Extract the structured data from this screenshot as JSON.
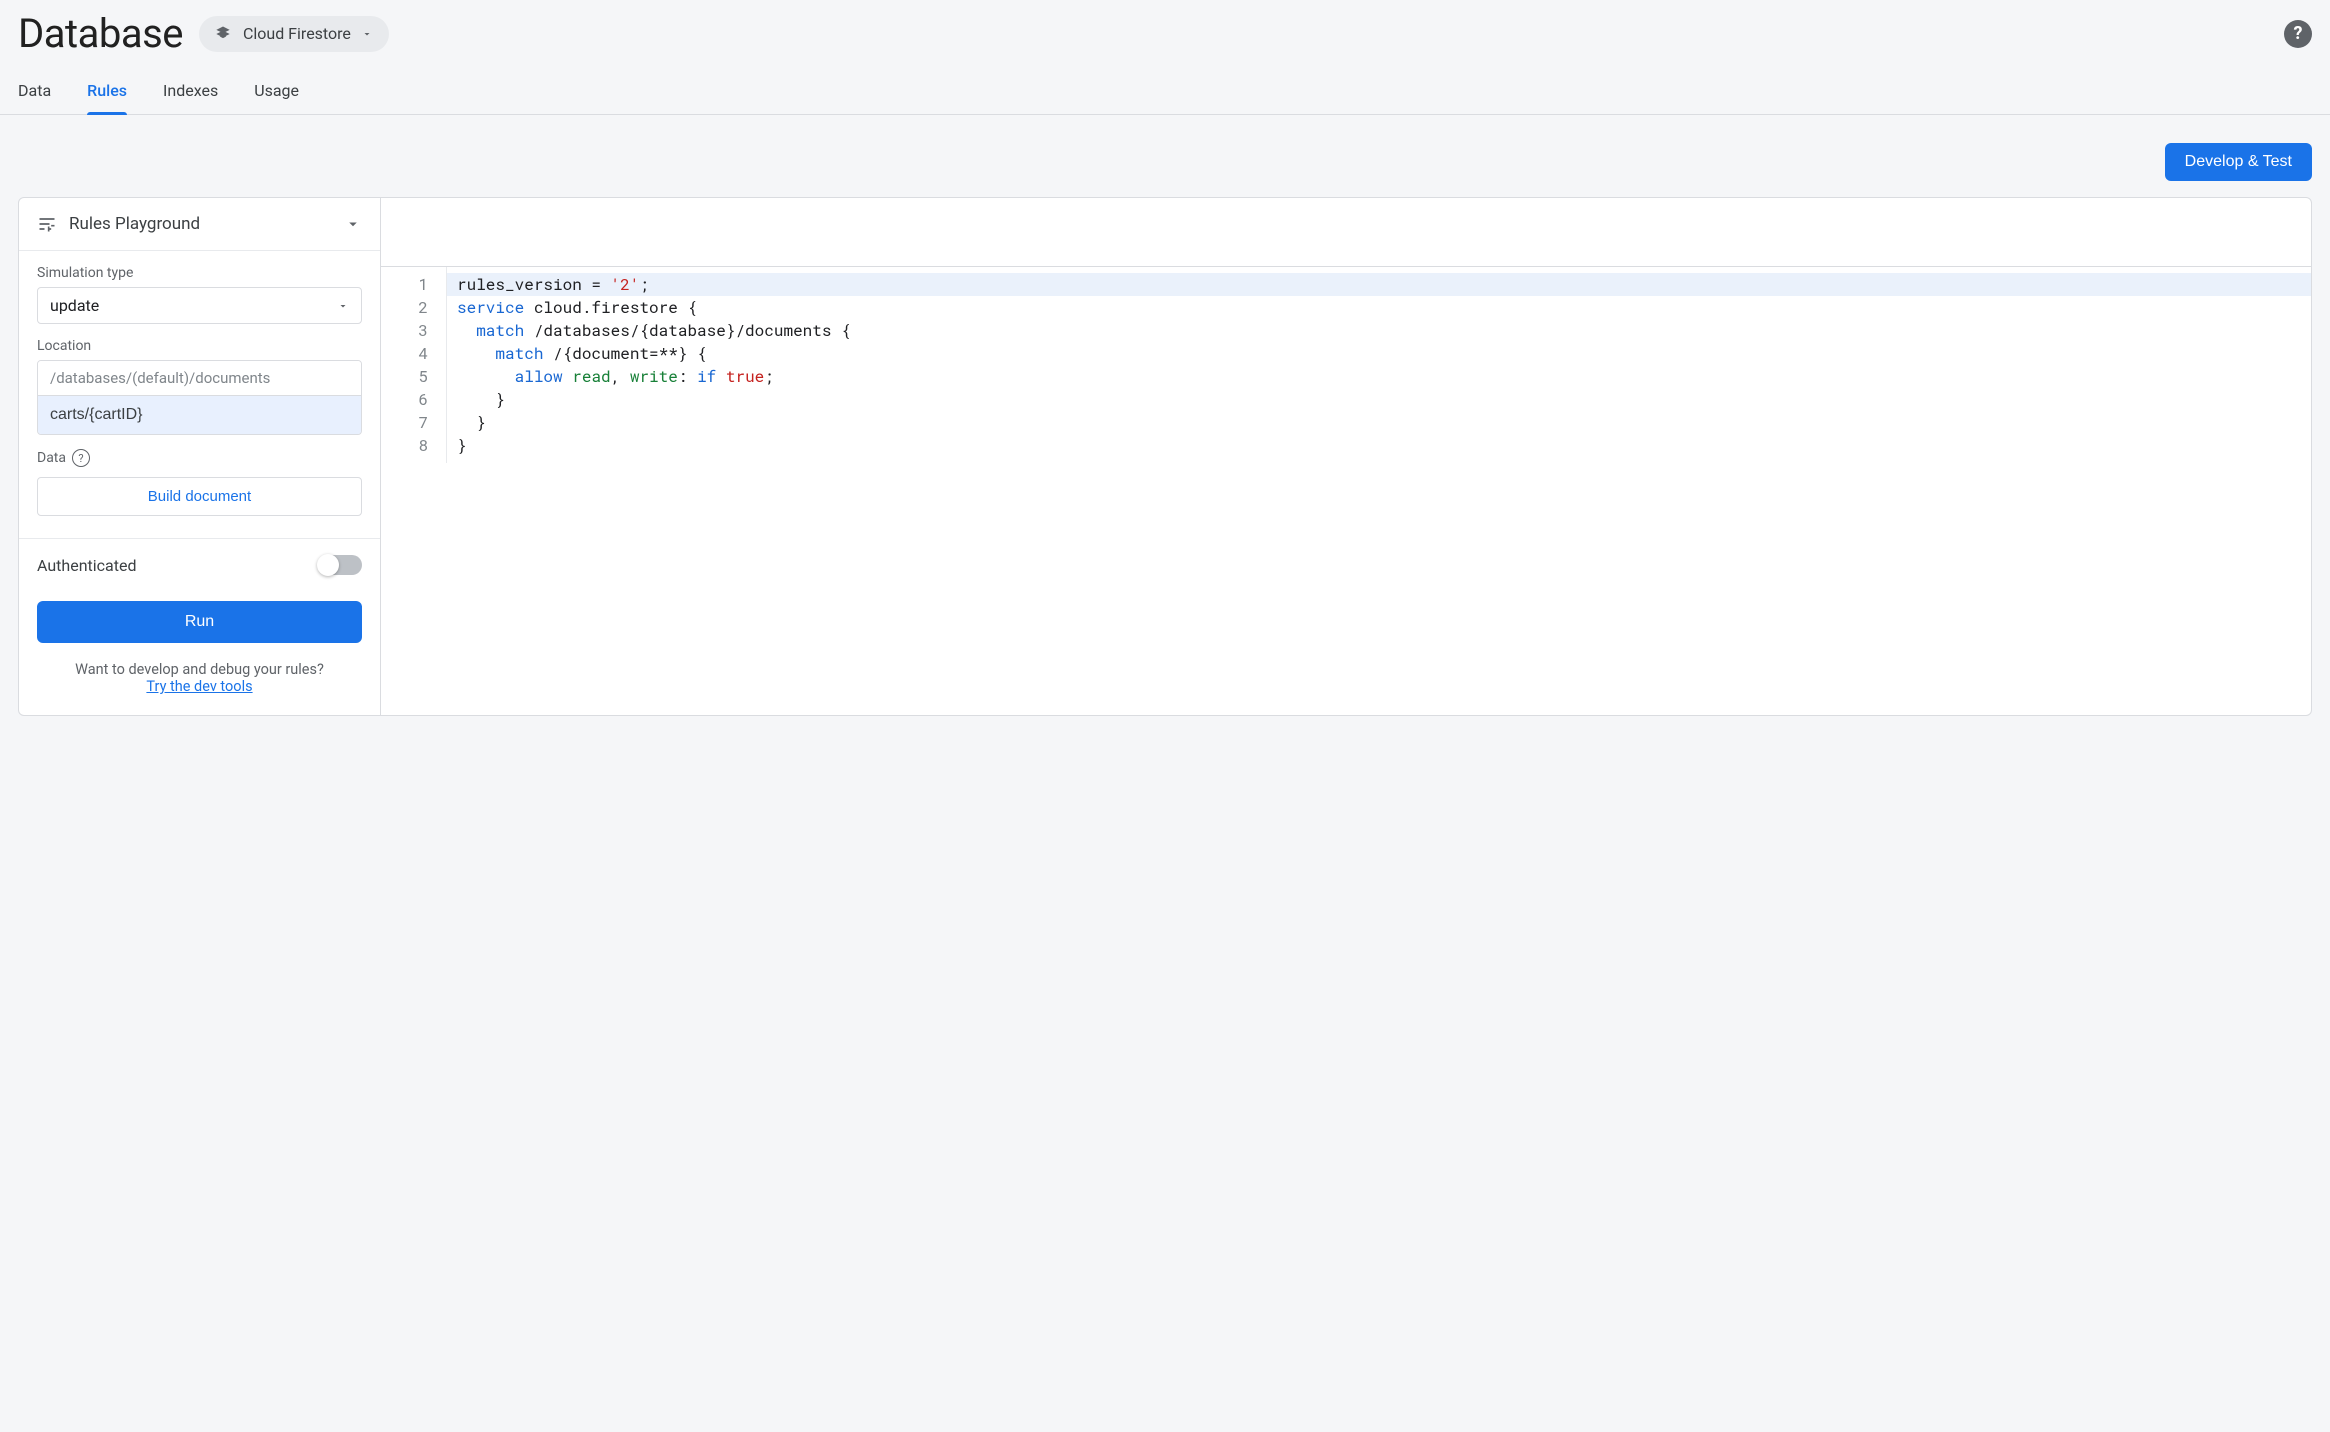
{
  "header": {
    "title": "Database",
    "db_selector": "Cloud Firestore"
  },
  "tabs": [
    {
      "label": "Data",
      "active": false
    },
    {
      "label": "Rules",
      "active": true
    },
    {
      "label": "Indexes",
      "active": false
    },
    {
      "label": "Usage",
      "active": false
    }
  ],
  "toolbar": {
    "develop_test": "Develop & Test"
  },
  "playground": {
    "title": "Rules Playground",
    "sim_type_label": "Simulation type",
    "sim_type_value": "update",
    "location_label": "Location",
    "location_prefix": "/databases/(default)/documents",
    "location_value": "carts/{cartID}",
    "data_label": "Data",
    "build_doc": "Build document",
    "auth_label": "Authenticated",
    "run": "Run",
    "footer_q": "Want to develop and debug your rules?",
    "footer_link": "Try the dev tools"
  },
  "editor": {
    "lines": [
      "rules_version = '2';",
      "service cloud.firestore {",
      "  match /databases/{database}/documents {",
      "    match /{document=**} {",
      "      allow read, write: if true;",
      "    }",
      "  }",
      "}"
    ]
  }
}
